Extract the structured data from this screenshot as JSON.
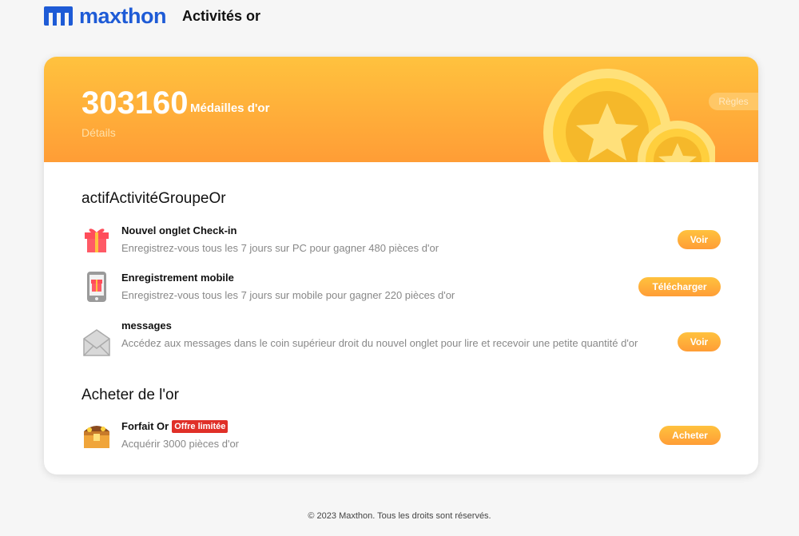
{
  "header": {
    "logo_text": "maxthon",
    "page_title": "Activités or"
  },
  "banner": {
    "gold_count": "303160",
    "gold_unit": "Médailles d'or",
    "details_label": "Détails",
    "rules_label": "Règles"
  },
  "sections": [
    {
      "title": "actifActivitéGroupeOr",
      "tasks": [
        {
          "icon": "gift-icon",
          "name": "Nouvel onglet Check-in",
          "description": "Enregistrez-vous tous les 7 jours sur PC pour gagner 480 pièces d'or",
          "button": "Voir"
        },
        {
          "icon": "mobile-gift-icon",
          "name": "Enregistrement mobile",
          "description": "Enregistrez-vous tous les 7 jours sur mobile pour gagner 220 pièces d'or",
          "button": "Télécharger"
        },
        {
          "icon": "envelope-icon",
          "name": "messages",
          "description": "Accédez aux messages dans le coin supérieur droit du nouvel onglet pour lire et recevoir une petite quantité d'or",
          "button": "Voir"
        }
      ]
    },
    {
      "title": "Acheter de l'or",
      "tasks": [
        {
          "icon": "treasure-chest-icon",
          "name": "Forfait Or",
          "badge": "Offre limitée",
          "description": "Acquérir 3000 pièces d'or",
          "button": "Acheter"
        }
      ]
    }
  ],
  "footer": {
    "copyright": "© 2023 Maxthon. Tous les droits sont réservés."
  },
  "colors": {
    "brand": "#1e5bd6",
    "accent_top": "#ffc23e",
    "accent_bottom": "#ff9d36",
    "badge": "#e03028"
  }
}
